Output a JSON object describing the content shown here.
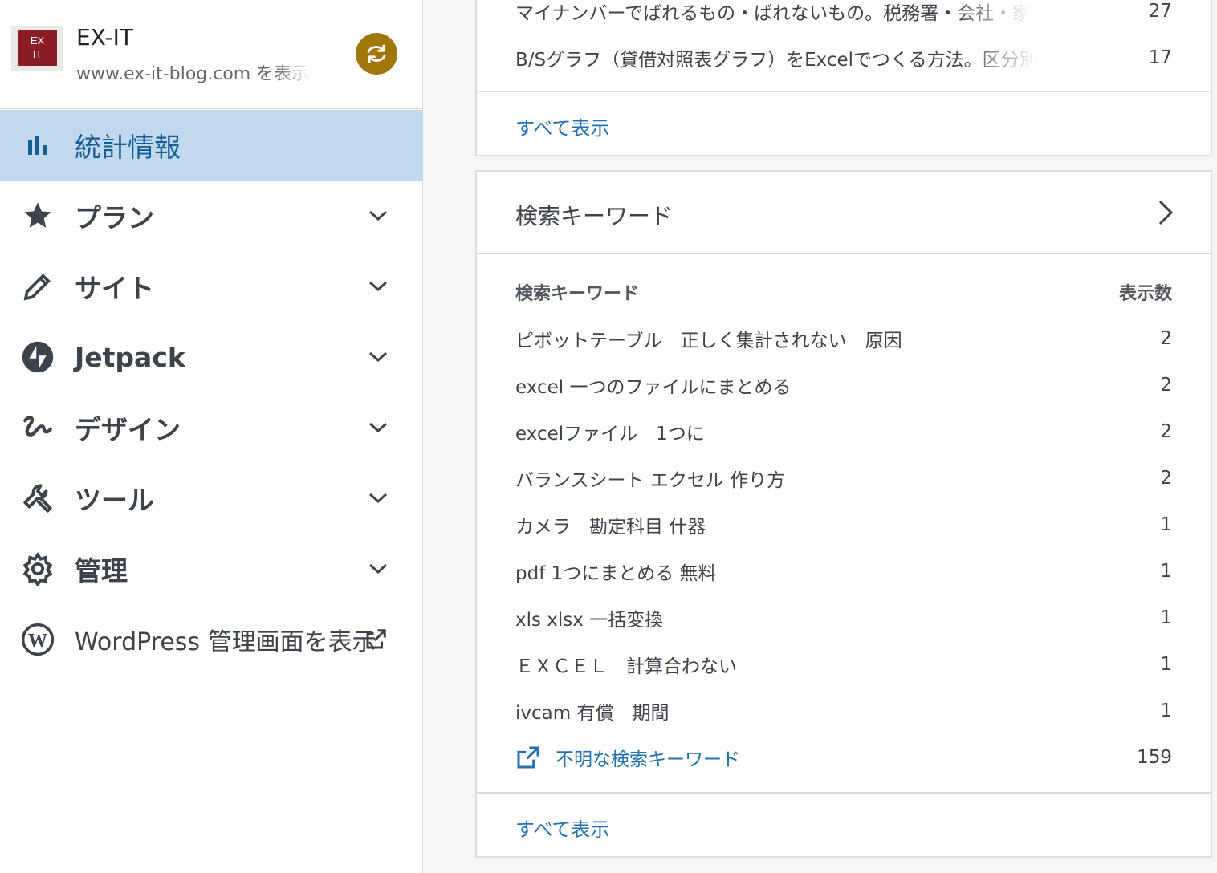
{
  "site": {
    "logo_text_top": "EX",
    "logo_text_bottom": "IT",
    "name": "EX-IT",
    "url": "www.ex-it-blog.com を表示"
  },
  "nav": {
    "stats": "統計情報",
    "plan": "プラン",
    "site": "サイト",
    "jetpack": "Jetpack",
    "design": "デザイン",
    "tools": "ツール",
    "manage": "管理",
    "wp_admin": "WordPress 管理画面を表示"
  },
  "top_card": {
    "rows": [
      {
        "title": "マイナンバーでばれるもの・ばれないもの。税務署・会社・家",
        "count": "27"
      },
      {
        "title": "B/Sグラフ（貸借対照表グラフ）をExcelでつくる方法。区分別",
        "count": "17"
      }
    ],
    "show_all": "すべて表示"
  },
  "search_card": {
    "title": "検索キーワード",
    "col_keyword": "検索キーワード",
    "col_views": "表示数",
    "rows": [
      {
        "keyword": "ピボットテーブル　正しく集計されない　原因",
        "count": "2"
      },
      {
        "keyword": "excel 一つのファイルにまとめる",
        "count": "2"
      },
      {
        "keyword": "excelファイル　1つに",
        "count": "2"
      },
      {
        "keyword": "バランスシート エクセル 作り方",
        "count": "2"
      },
      {
        "keyword": "カメラ　勘定科目 什器",
        "count": "1"
      },
      {
        "keyword": "pdf 1つにまとめる 無料",
        "count": "1"
      },
      {
        "keyword": "xls xlsx 一括変換",
        "count": "1"
      },
      {
        "keyword": "ＥＸＣＥＬ　計算合わない",
        "count": "1"
      },
      {
        "keyword": "ivcam 有償　期間",
        "count": "1"
      }
    ],
    "unknown_label": "不明な検索キーワード",
    "unknown_count": "159",
    "show_all": "すべて表示"
  },
  "colors": {
    "accent": "#2271b1",
    "active_bg": "#c2d8ed",
    "switch_bg": "#a1760b"
  }
}
